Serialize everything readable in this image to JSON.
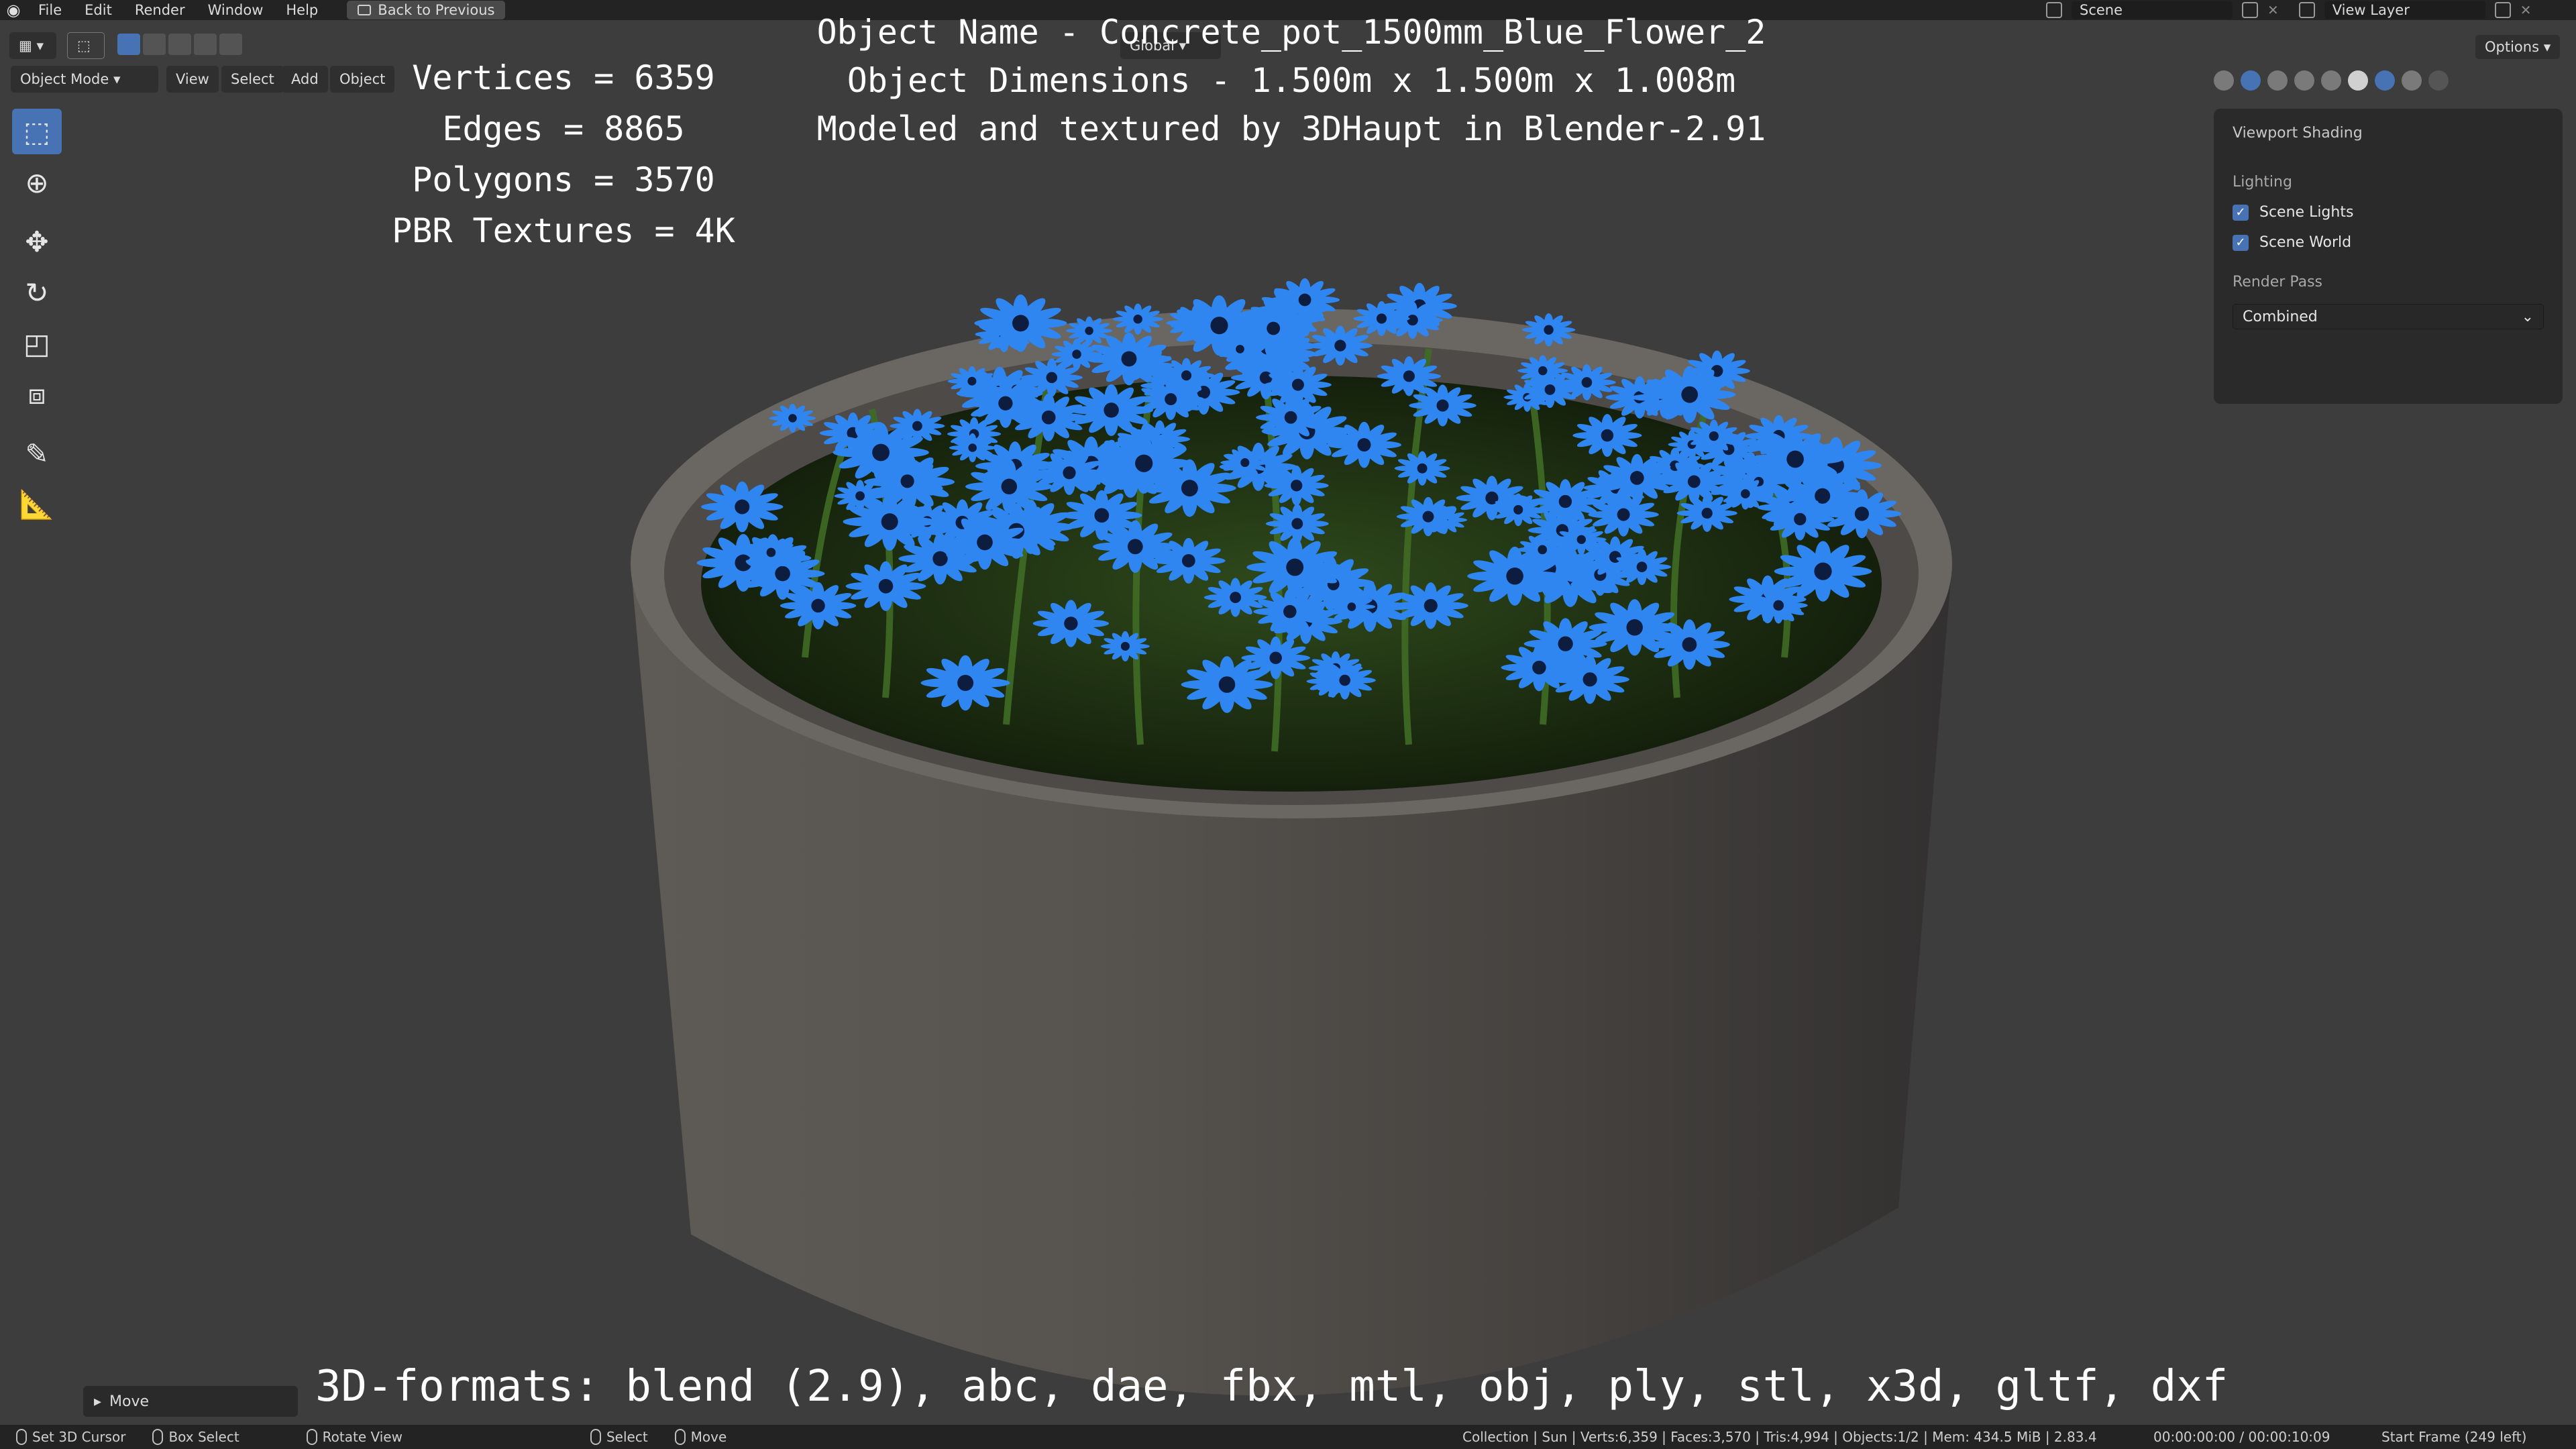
{
  "topbar": {
    "menus": [
      "File",
      "Edit",
      "Render",
      "Window",
      "Help"
    ],
    "back_button": "Back to Previous",
    "scene_label": "Scene",
    "view_layer_label": "View Layer"
  },
  "header": {
    "mode": "Object Mode",
    "menus": [
      "View",
      "Select",
      "Add",
      "Object"
    ],
    "transform": "Global",
    "options": "Options"
  },
  "overlay": {
    "stats": [
      "Vertices = 6359",
      "Edges = 8865",
      "Polygons = 3570",
      "PBR Textures = 4K"
    ],
    "info": [
      "Object Name - Concrete_pot_1500mm_Blue_Flower_2",
      "Object Dimensions -  1.500m x 1.500m x 1.008m",
      "Modeled and textured by 3DHaupt in Blender-2.91"
    ],
    "formats": "3D-formats: blend (2.9), abc, dae, fbx, mtl, obj, ply, stl, x3d, gltf, dxf"
  },
  "shading_panel": {
    "title": "Viewport Shading",
    "lighting_label": "Lighting",
    "scene_lights": "Scene Lights",
    "scene_world": "Scene World",
    "render_pass_label": "Render Pass",
    "render_pass_value": "Combined"
  },
  "move_panel": {
    "label": "Move"
  },
  "statusbar": {
    "set_cursor": "Set 3D Cursor",
    "box_select": "Box Select",
    "rotate_view": "Rotate View",
    "select": "Select",
    "move": "Move",
    "scene_stats": "Collection | Sun | Verts:6,359 | Faces:3,570 | Tris:4,994 | Objects:1/2 | Mem: 434.5 MiB | 2.83.4",
    "time": "00:00:00:00 / 00:00:10:09",
    "start_frame": "Start Frame (249 left)"
  },
  "colors": {
    "accent": "#4772b3",
    "viewport_bg": "#3d3d3d",
    "flower_blue": "#1e6fe0"
  },
  "icons": [
    "blender-logo-icon",
    "select-box-icon",
    "cursor-icon",
    "move-icon",
    "rotate-icon",
    "scale-icon",
    "transform-icon",
    "annotate-icon",
    "measure-icon"
  ]
}
